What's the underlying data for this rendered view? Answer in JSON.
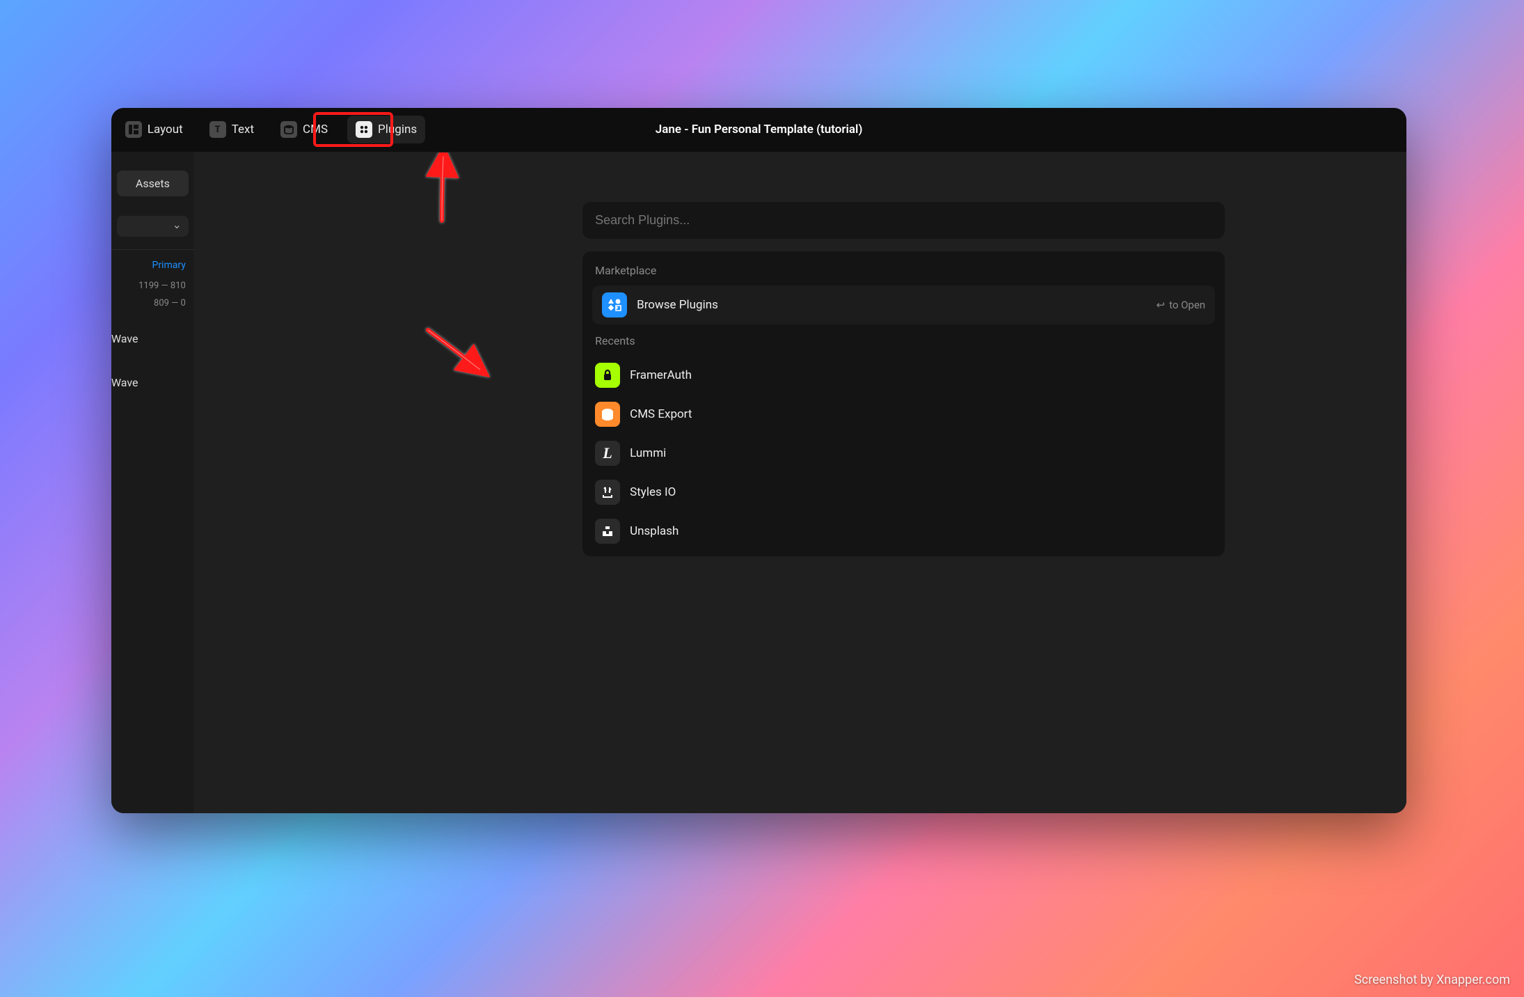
{
  "toolbar": {
    "items": [
      {
        "id": "layout",
        "label": "Layout"
      },
      {
        "id": "text",
        "label": "Text"
      },
      {
        "id": "cms",
        "label": "CMS"
      },
      {
        "id": "plugins",
        "label": "Plugins"
      }
    ],
    "title": "Jane - Fun Personal Template (tutorial)"
  },
  "sidebar": {
    "assets_label": "Assets",
    "primary_label": "Primary",
    "range1": "1199 — 810",
    "range2": "809 — 0",
    "wave1": "Wave",
    "wave2": "Wave"
  },
  "plugins_panel": {
    "search_placeholder": "Search Plugins...",
    "marketplace_label": "Marketplace",
    "browse_label": "Browse Plugins",
    "open_hint": "to Open",
    "recents_label": "Recents",
    "recents": [
      {
        "id": "framerauth",
        "label": "FramerAuth",
        "icon": "auth"
      },
      {
        "id": "cmsexport",
        "label": "CMS Export",
        "icon": "cms"
      },
      {
        "id": "lummi",
        "label": "Lummi",
        "icon": "lummi"
      },
      {
        "id": "stylesio",
        "label": "Styles IO",
        "icon": "styles"
      },
      {
        "id": "unsplash",
        "label": "Unsplash",
        "icon": "unspl"
      }
    ]
  },
  "watermark": "Screenshot by Xnapper.com"
}
